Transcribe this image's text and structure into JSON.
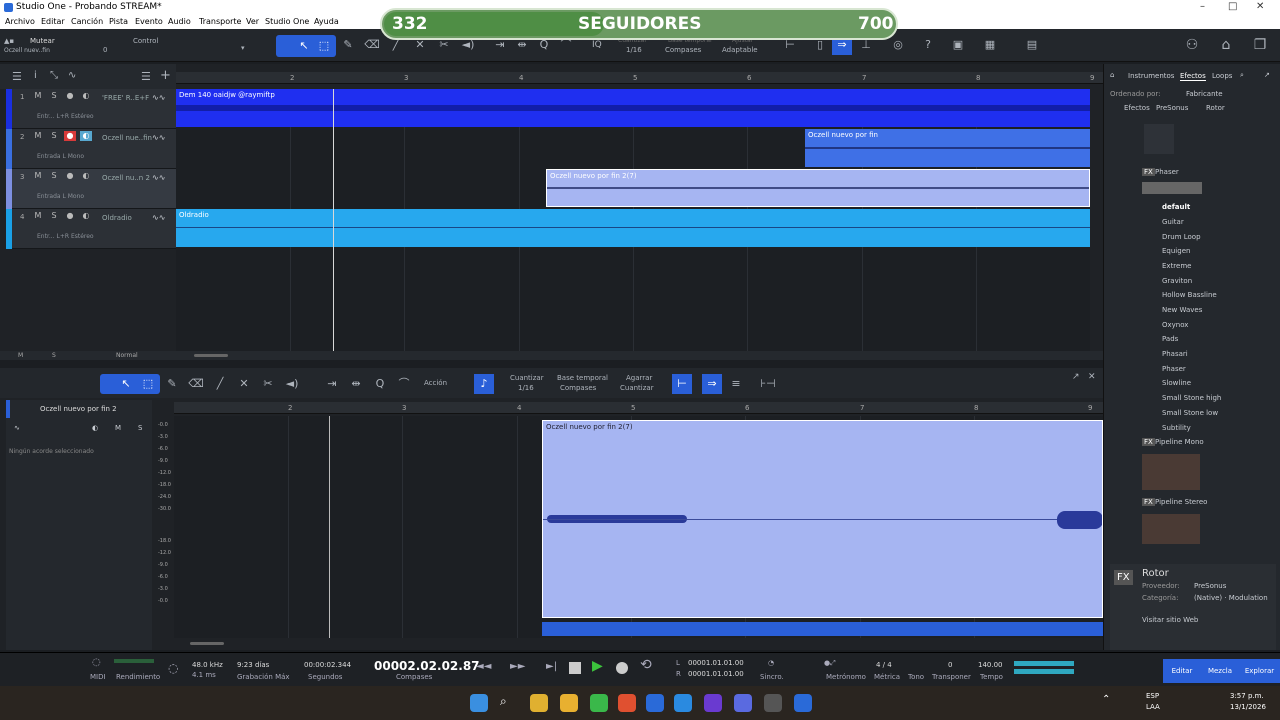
{
  "window": {
    "title": "Studio One - Probando STREAM*",
    "min": "–",
    "max": "□",
    "close": "✕"
  },
  "menu": [
    "Archivo",
    "Editar",
    "Canción",
    "Pista",
    "Evento",
    "Audio",
    "Transporte",
    "Ver",
    "Studio One",
    "Ayuda"
  ],
  "overlay": {
    "left": "332",
    "center": "SEGUIDORES",
    "right": "700"
  },
  "toolbar": {
    "mute_label": "Mutear",
    "track_name": "Oczell nuev..fin",
    "zero": "0",
    "control": "Control",
    "quantize_label": "Cuantizar",
    "quantize_val": "1/16",
    "timebase_label": "Base temporal",
    "timebase_val": "Compases",
    "snap_label": "Ajustar",
    "snap_val": "Adaptable",
    "iq": "IQ"
  },
  "ruler": [
    "2",
    "3",
    "4",
    "5",
    "6",
    "7",
    "8",
    "9"
  ],
  "tracks": [
    {
      "num": "1",
      "name": "'FREE' R..E+F",
      "sub": "Entr... L+R Estéreo",
      "color": "#1a2fe0"
    },
    {
      "num": "2",
      "name": "Oczell nue..fin",
      "sub": "Entrada L  Mono",
      "color": "#3a6fe0"
    },
    {
      "num": "3",
      "name": "Oczell nu..n  2",
      "sub": "Entrada L  Mono",
      "color": "#7d8fe0"
    },
    {
      "num": "4",
      "name": "Oldradio",
      "sub": "Entr... L+R Estéreo",
      "color": "#1aa0e6"
    }
  ],
  "clips": {
    "c1": "Dem 140 oaidjw @raymiftp",
    "c2": "Oczell nuevo por fin",
    "c3": "Oczell nuevo por fin  2(7)",
    "c4": "Oldradio"
  },
  "arrange_footer": {
    "m": "M",
    "s": "S",
    "normal": "Normal"
  },
  "browser": {
    "tabs": [
      "Instrumentos",
      "Efectos",
      "Loops"
    ],
    "sort_label": "Ordenado por:",
    "sort_val": "Fabricante",
    "crumbs": [
      "Efectos",
      "PreSonus",
      "Rotor"
    ],
    "phaser": "Phaser",
    "items": [
      "default",
      "Guitar",
      "Drum Loop",
      "Equigen",
      "Extreme",
      "Graviton",
      "Hollow Bassline",
      "New Waves",
      "Oxynox",
      "Pads",
      "Phasari",
      "Phaser",
      "Slowline",
      "Small Stone high",
      "Small Stone low",
      "Subtility"
    ],
    "pipe_mono": "Pipeline Mono",
    "pipe_stereo": "Pipeline Stereo",
    "info": {
      "name": "Rotor",
      "vendor_l": "Proveedor:",
      "vendor": "PreSonus",
      "cat_l": "Categoría:",
      "cat": "(Native) · Modulation",
      "web": "Visitar sitio Web",
      "fx": "FX"
    }
  },
  "editor": {
    "accion": "Acción",
    "quantize_label": "Cuantizar",
    "quantize_val": "1/16",
    "timebase_label": "Base temporal",
    "timebase_val": "Compases",
    "grab_label": "Agarrar",
    "grab_val": "Cuantizar",
    "track": "Oczell nuevo por fin  2",
    "m": "M",
    "s": "S",
    "chords": "Ningún acorde seleccionado",
    "clip": "Oczell nuevo por fin  2(7)",
    "db": [
      "-0.0",
      "-3.0",
      "-6.0",
      "-9.0",
      "-12.0",
      "-18.0",
      "-24.0",
      "-30.0",
      "-18.0",
      "-12.0",
      "-9.0",
      "-6.0",
      "-3.0",
      "-0.0"
    ]
  },
  "transport": {
    "midi": "MIDI",
    "perf": "Rendimiento",
    "rate": "48.0 kHz",
    "latency": "4.1 ms",
    "rec": "9:23 días",
    "rec_label": "Grabación Máx",
    "sec": "00:00:02.344",
    "sec_label": "Segundos",
    "bars": "00002.02.02.87",
    "bars_label": "Compases",
    "l": "00001.01.01.00",
    "r": "00001.01.01.00",
    "sync": "Sincro.",
    "metro": "Metrónomo",
    "sig": "4 / 4",
    "sig_label": "Métrica",
    "tone": "Tono",
    "transp": "0",
    "transp_label": "Transponer",
    "tempo": "140.00",
    "tempo_label": "Tempo",
    "edit": "Editar",
    "mix": "Mezcla",
    "explore": "Explorar"
  },
  "taskbar": {
    "lang": "ESP",
    "lang2": "LAA",
    "time": "3:57 p.m.",
    "date": "13/1/2026"
  }
}
